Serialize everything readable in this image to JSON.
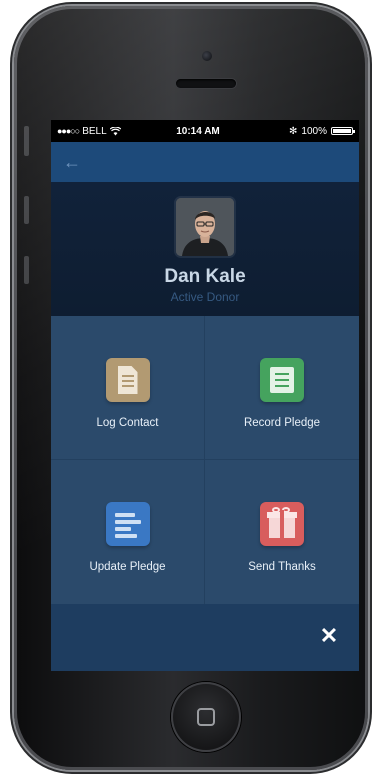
{
  "status_bar": {
    "signal": "●●●○○",
    "carrier": "BELL",
    "time": "10:14 AM",
    "bluetooth": "✻",
    "battery": "100%"
  },
  "nav": {
    "back_icon": "←"
  },
  "profile": {
    "name": "Dan Kale",
    "status": "Active Donor"
  },
  "actions": [
    {
      "label": "Log Contact",
      "icon": "document-icon",
      "color": "#b29a72"
    },
    {
      "label": "Record Pledge",
      "icon": "pledge-card-icon",
      "color": "#45a35e"
    },
    {
      "label": "Update Pledge",
      "icon": "update-list-icon",
      "color": "#3a78c4"
    },
    {
      "label": "Send Thanks",
      "icon": "gift-icon",
      "color": "#d85d5d"
    }
  ],
  "footer": {
    "close_icon": "✕"
  }
}
